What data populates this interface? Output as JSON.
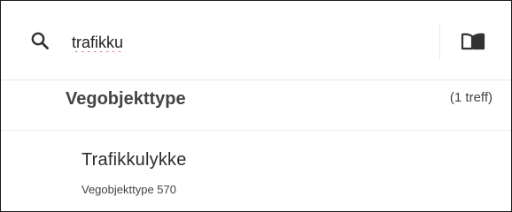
{
  "search": {
    "value": "trafikku",
    "icon": "search-icon",
    "book_icon": "book-icon"
  },
  "category": {
    "title": "Vegobjekttype",
    "count": "(1 treff)"
  },
  "results": [
    {
      "title": "Trafikkulykke",
      "subtitle": "Vegobjekttype 570"
    }
  ],
  "colors": {
    "text_dark": "#2b2b2b",
    "text_medium": "#444444",
    "divider": "#e6e6e6",
    "spellcheck_underline": "#d02020"
  }
}
